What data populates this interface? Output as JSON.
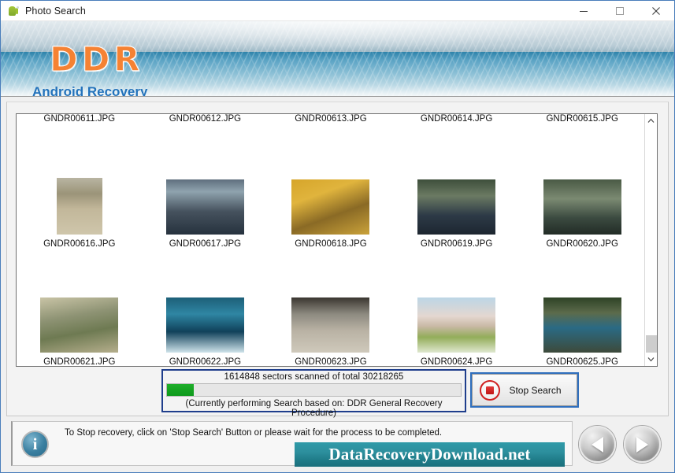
{
  "window": {
    "title": "Photo Search",
    "app_icon": "android-droid-icon",
    "controls": [
      {
        "name": "minimize",
        "glyph": "minimize-icon"
      },
      {
        "name": "maximize",
        "glyph": "maximize-icon"
      },
      {
        "name": "close",
        "glyph": "close-icon"
      }
    ]
  },
  "header": {
    "logo": "DDR",
    "subtitle": "Android Recovery"
  },
  "thumbnails": {
    "items": [
      {
        "caption": "GNDR00611.JPG"
      },
      {
        "caption": "GNDR00612.JPG"
      },
      {
        "caption": "GNDR00613.JPG"
      },
      {
        "caption": "GNDR00614.JPG"
      },
      {
        "caption": "GNDR00615.JPG"
      },
      {
        "caption": "GNDR00616.JPG"
      },
      {
        "caption": "GNDR00617.JPG"
      },
      {
        "caption": "GNDR00618.JPG"
      },
      {
        "caption": "GNDR00619.JPG"
      },
      {
        "caption": "GNDR00620.JPG"
      },
      {
        "caption": "GNDR00621.JPG"
      },
      {
        "caption": "GNDR00622.JPG"
      },
      {
        "caption": "GNDR00623.JPG"
      },
      {
        "caption": "GNDR00624.JPG"
      },
      {
        "caption": "GNDR00625.JPG"
      }
    ],
    "scrollbar": {
      "up_glyph": "chevron-up-icon",
      "down_glyph": "chevron-down-icon"
    }
  },
  "progress": {
    "status_text": "1614848  sectors scanned of total 30218265",
    "sectors_scanned": 1614848,
    "sectors_total": 30218265,
    "percent": 9,
    "note": "(Currently performing Search based on:  DDR General Recovery Procedure)",
    "fill_color": "#15a321"
  },
  "stop_button": {
    "label": "Stop Search",
    "icon": "stop-square-icon",
    "accent_color": "#cf2020"
  },
  "status_bar": {
    "icon": "info-icon",
    "icon_glyph": "i",
    "message": "To Stop recovery, click on 'Stop Search' Button or please wait for the process to be completed.",
    "brand": "DataRecoveryDownload.net",
    "brand_color": "#2d8f9d"
  },
  "navigation": {
    "prev": "previous-button",
    "next": "next-button"
  }
}
